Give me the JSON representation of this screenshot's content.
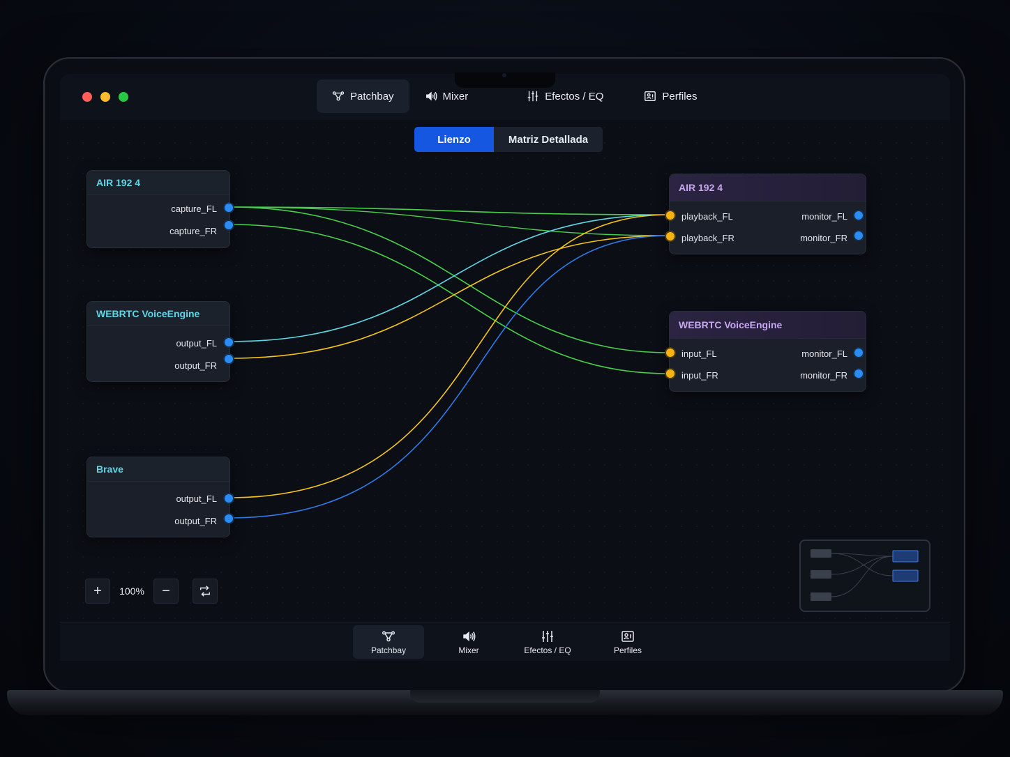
{
  "window": {
    "controls": [
      "close",
      "minimize",
      "zoom"
    ]
  },
  "top_nav": [
    {
      "label": "Patchbay",
      "icon": "patchbay-icon",
      "active": true
    },
    {
      "label": "Mixer",
      "icon": "speaker-icon",
      "active": false
    },
    {
      "label": "Efectos / EQ",
      "icon": "sliders-icon",
      "active": false
    },
    {
      "label": "Perfiles",
      "icon": "profile-icon",
      "active": false
    }
  ],
  "view_toggle": {
    "options": [
      "Lienzo",
      "Matriz Detallada"
    ],
    "selected": "Lienzo"
  },
  "nodes": {
    "src_air": {
      "title": "AIR 192 4",
      "ports": [
        "capture_FL",
        "capture_FR"
      ]
    },
    "src_webrtc": {
      "title": "WEBRTC VoiceEngine",
      "ports": [
        "output_FL",
        "output_FR"
      ]
    },
    "src_brave": {
      "title": "Brave",
      "ports": [
        "output_FL",
        "output_FR"
      ]
    },
    "dst_air": {
      "title": "AIR 192 4",
      "inputs": [
        "playback_FL",
        "playback_FR"
      ],
      "outputs": [
        "monitor_FL",
        "monitor_FR"
      ]
    },
    "dst_webrtc": {
      "title": "WEBRTC VoiceEngine",
      "inputs": [
        "input_FL",
        "input_FR"
      ],
      "outputs": [
        "monitor_FL",
        "monitor_FR"
      ]
    }
  },
  "connections": [
    {
      "from": "AIR 192 4:capture_FL",
      "to": "AIR 192 4:playback_FL",
      "color": "#47d14a"
    },
    {
      "from": "AIR 192 4:capture_FL",
      "to": "WEBRTC VoiceEngine:input_FL",
      "color": "#47d14a"
    },
    {
      "from": "AIR 192 4:capture_FR",
      "to": "WEBRTC VoiceEngine:input_FR",
      "color": "#47d14a"
    },
    {
      "from": "AIR 192 4:capture_FL",
      "to": "AIR 192 4:playback_FR",
      "color": "#47d14a"
    },
    {
      "from": "WEBRTC VoiceEngine:output_FL",
      "to": "AIR 192 4:playback_FL",
      "color": "#5fd6e6"
    },
    {
      "from": "WEBRTC VoiceEngine:output_FR",
      "to": "AIR 192 4:playback_FR",
      "color": "#f5c518"
    },
    {
      "from": "Brave:output_FL",
      "to": "AIR 192 4:playback_FL",
      "color": "#f5c518"
    },
    {
      "from": "Brave:output_FR",
      "to": "AIR 192 4:playback_FR",
      "color": "#2f7be8"
    }
  ],
  "zoom": {
    "value": "100%",
    "plus": "+",
    "minus": "−"
  },
  "colors": {
    "accent": "#1557e0",
    "port_out": "#2b8cf6",
    "port_in": "#f5b414",
    "src_title": "#5fd6e6",
    "dst_title": "#c7a6ef"
  },
  "bottom_nav": [
    {
      "label": "Patchbay",
      "icon": "patchbay-icon",
      "active": true
    },
    {
      "label": "Mixer",
      "icon": "speaker-icon",
      "active": false
    },
    {
      "label": "Efectos / EQ",
      "icon": "sliders-icon",
      "active": false
    },
    {
      "label": "Perfiles",
      "icon": "profile-icon",
      "active": false
    }
  ]
}
